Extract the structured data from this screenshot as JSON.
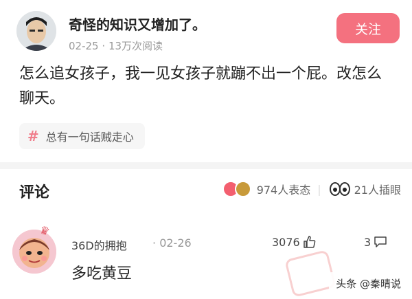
{
  "post": {
    "author": "奇怪的知识又增加了。",
    "date": "02-25",
    "dot": "·",
    "views": "13万次阅读",
    "follow_label": "关注",
    "body": "怎么追女孩子，我一见女孩子就蹦不出一个屁。改怎么聊天。",
    "topic_hash": "#",
    "topic": "总有一句话贼走心"
  },
  "comments_section": {
    "title": "评论",
    "reaction_count": "974人表态",
    "separator": "|",
    "blink_count": "21人插眼",
    "icons": [
      "like-reaction-icon",
      "salute-reaction-icon",
      "eyes-icon"
    ]
  },
  "comment": {
    "author": "36D的拥抱",
    "dot": "·",
    "date": "02-26",
    "likes": "3076",
    "replies": "3",
    "text": "多吃黄豆"
  },
  "source": "头条 @秦晴说",
  "colors": {
    "follow_button": "#f4717f",
    "topic_hash": "#f07d8b",
    "muted_text": "#999999"
  }
}
